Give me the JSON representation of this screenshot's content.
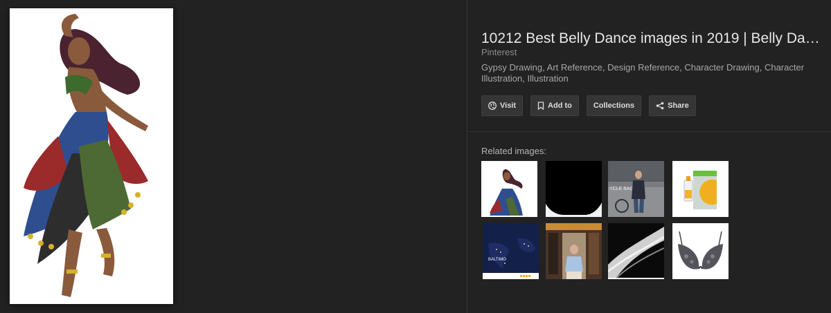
{
  "result": {
    "title": "10212 Best Belly Dance images in 2019 | Belly Dance ...",
    "source": "Pinterest",
    "tags": "Gypsy Drawing, Art Reference, Design Reference, Character Drawing, Character Illustration, Illustration"
  },
  "actions": {
    "visit_label": "Visit",
    "add_to_label": "Add to",
    "collections_label": "Collections",
    "share_label": "Share"
  },
  "related": {
    "label": "Related images:",
    "thumb_texts": {
      "bicycle_sign": "YCLE BAG",
      "dark_brand": "BALTIMO"
    }
  },
  "colors": {
    "background": "#222222",
    "button_bg": "#353535",
    "title": "#e8e8e8",
    "muted": "#8c8c8c"
  }
}
